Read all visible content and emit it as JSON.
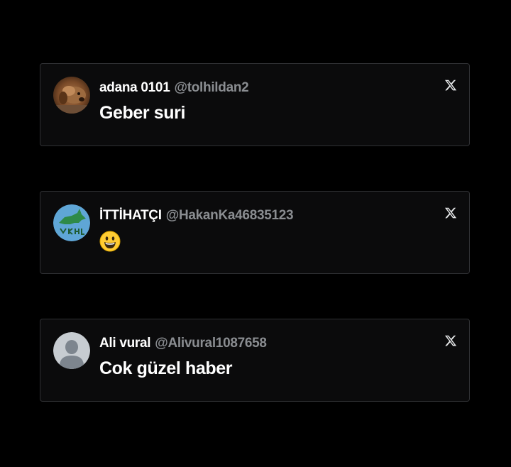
{
  "posts": [
    {
      "display_name": "adana 0101",
      "handle": "@tolhildan2",
      "text": "Geber suri",
      "avatar_icon": "dog-photo-avatar",
      "logo_icon": "x-logo-icon"
    },
    {
      "display_name": "İTTİHATÇI",
      "handle": "@HakanKa46835123",
      "text": "😀",
      "avatar_icon": "grey-wolf-emblem-avatar",
      "logo_icon": "x-logo-icon"
    },
    {
      "display_name": "Ali vural",
      "handle": "@Alivural1087658",
      "text": "Cok güzel haber",
      "avatar_icon": "default-profile-avatar",
      "logo_icon": "x-logo-icon"
    }
  ],
  "colors": {
    "background": "#000000",
    "card": "#0b0b0c",
    "card_border": "#2f3033",
    "name": "#ffffff",
    "handle": "#8a8d91",
    "text": "#ffffff"
  }
}
